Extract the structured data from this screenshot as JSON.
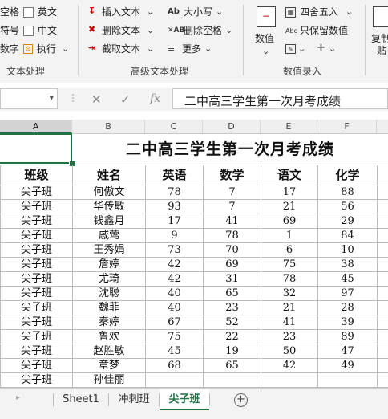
{
  "ribbon": {
    "group1": {
      "items": [
        "空格",
        "符号",
        "数字"
      ],
      "checkboxes": [
        "英文",
        "中文"
      ],
      "execute_label": "执行",
      "label": "文本处理"
    },
    "group2": {
      "insert_label": "插入文本",
      "delete_label": "删除文本",
      "extract_label": "截取文本",
      "case_label": "大小写",
      "delete_space_label": "删除空格",
      "more_label": "更多",
      "label": "高级文本处理"
    },
    "group3": {
      "numeric_label": "数值",
      "round_label": "四舍五入",
      "keep_valid_label": "只保留数值",
      "label": "数值录入"
    },
    "group4": {
      "copy_label": "复制",
      "paste_label": "贴"
    }
  },
  "formula_bar": {
    "cancel": "✕",
    "confirm": "✓",
    "fx": "fx",
    "content": "二中高三学生第一次月考成绩"
  },
  "columns": [
    "A",
    "B",
    "C",
    "D",
    "E",
    "F"
  ],
  "sheet": {
    "title": "二中高三学生第一次月考成绩",
    "headers": [
      "班级",
      "姓名",
      "英语",
      "数学",
      "语文",
      "化学"
    ],
    "rows": [
      [
        "尖子班",
        "何傲文",
        "78",
        "7",
        "17",
        "88"
      ],
      [
        "尖子班",
        "华传敏",
        "93",
        "7",
        "21",
        "56"
      ],
      [
        "尖子班",
        "钱鑫月",
        "17",
        "41",
        "69",
        "29"
      ],
      [
        "尖子班",
        "戚莺",
        "9",
        "78",
        "1",
        "84"
      ],
      [
        "尖子班",
        "王秀娟",
        "73",
        "70",
        "6",
        "10"
      ],
      [
        "尖子班",
        "詹婷",
        "42",
        "69",
        "75",
        "38"
      ],
      [
        "尖子班",
        "尤琦",
        "42",
        "31",
        "78",
        "45"
      ],
      [
        "尖子班",
        "沈聪",
        "40",
        "65",
        "32",
        "97"
      ],
      [
        "尖子班",
        "魏菲",
        "40",
        "23",
        "21",
        "28"
      ],
      [
        "尖子班",
        "秦婷",
        "67",
        "52",
        "41",
        "39"
      ],
      [
        "尖子班",
        "鲁欢",
        "75",
        "22",
        "23",
        "89"
      ],
      [
        "尖子班",
        "赵胜敏",
        "45",
        "19",
        "50",
        "47"
      ],
      [
        "尖子班",
        "章梦",
        "68",
        "65",
        "42",
        "49"
      ],
      [
        "尖子班",
        "孙佳丽",
        "",
        "",
        "",
        ""
      ]
    ]
  },
  "tabs": {
    "items": [
      "Sheet1",
      "冲刺班",
      "尖子班"
    ],
    "active": "尖子班",
    "add": "+"
  },
  "colors": {
    "accent": "#217346"
  }
}
